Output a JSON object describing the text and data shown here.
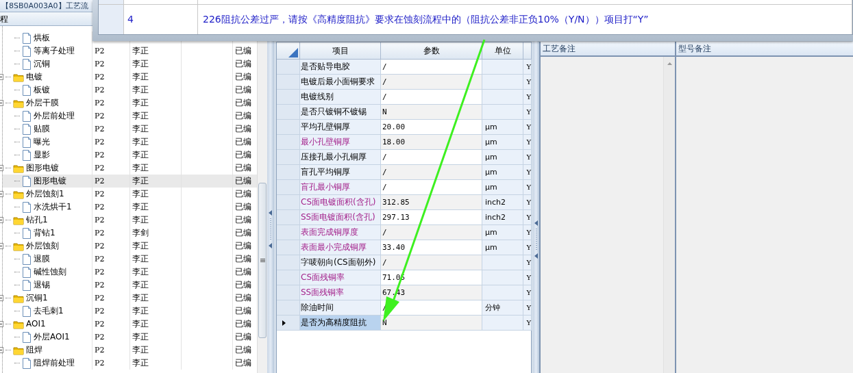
{
  "left_panel": {
    "title": "【8SB0A003A0】工艺流",
    "column_1": "程",
    "tree": [
      {
        "children": [
          {
            "label": "烘板",
            "selected": false
          },
          {
            "label": "等离子处理",
            "code": "P2",
            "owner": "李正",
            "status": "已编",
            "selected": false
          },
          {
            "label": "沉铜",
            "code": "P2",
            "owner": "李正",
            "status": "已编",
            "selected": false
          }
        ]
      },
      {
        "label": "电镀",
        "code": "P2",
        "owner": "李正",
        "status": "已编",
        "expanded": true,
        "selected": false,
        "children": [
          {
            "label": "板镀",
            "code": "P2",
            "owner": "李正",
            "status": "已编",
            "selected": false
          }
        ]
      },
      {
        "label": "外层干膜",
        "code": "P2",
        "owner": "李正",
        "status": "已编",
        "expanded": true,
        "selected": false,
        "children": [
          {
            "label": "外层前处理",
            "code": "P2",
            "owner": "李正",
            "status": "已编",
            "selected": false
          },
          {
            "label": "贴膜",
            "code": "P2",
            "owner": "李正",
            "status": "已编",
            "selected": false
          },
          {
            "label": "曝光",
            "code": "P2",
            "owner": "李正",
            "status": "已编",
            "selected": false
          },
          {
            "label": "显影",
            "code": "P2",
            "owner": "李正",
            "status": "已编",
            "selected": false
          }
        ]
      },
      {
        "label": "图形电镀",
        "code": "P2",
        "owner": "李正",
        "status": "已编",
        "expanded": true,
        "selected": false,
        "children": [
          {
            "label": "图形电镀",
            "code": "P2",
            "owner": "李正",
            "status": "已编",
            "selected": true
          }
        ]
      },
      {
        "label": "外层蚀刻1",
        "code": "P2",
        "owner": "李正",
        "status": "已编",
        "expanded": true,
        "selected": false,
        "children": [
          {
            "label": "水洗烘干1",
            "code": "P2",
            "owner": "李正",
            "status": "已编",
            "selected": false
          }
        ]
      },
      {
        "label": "钻孔1",
        "code": "P2",
        "owner": "李正",
        "status": "已编",
        "expanded": true,
        "selected": false,
        "children": [
          {
            "label": "背钻1",
            "code": "P2",
            "owner": "李剑",
            "status": "已编",
            "selected": false
          }
        ]
      },
      {
        "label": "外层蚀刻",
        "code": "P2",
        "owner": "李正",
        "status": "已编",
        "expanded": true,
        "selected": false,
        "children": [
          {
            "label": "退膜",
            "code": "P2",
            "owner": "李正",
            "status": "已编",
            "selected": false
          },
          {
            "label": "碱性蚀刻",
            "code": "P2",
            "owner": "李正",
            "status": "已编",
            "selected": false
          },
          {
            "label": "退锡",
            "code": "P2",
            "owner": "李正",
            "status": "已编",
            "selected": false
          }
        ]
      },
      {
        "label": "沉铜1",
        "code": "P2",
        "owner": "李正",
        "status": "已编",
        "expanded": true,
        "selected": false,
        "children": [
          {
            "label": "去毛刺1",
            "code": "P2",
            "owner": "李正",
            "status": "已编",
            "selected": false
          }
        ]
      },
      {
        "label": "AOI1",
        "code": "P2",
        "owner": "李正",
        "status": "已编",
        "expanded": true,
        "selected": false,
        "children": [
          {
            "label": "外层AOI1",
            "code": "P2",
            "owner": "李正",
            "status": "已编",
            "selected": false
          }
        ]
      },
      {
        "label": "阻焊",
        "code": "P2",
        "owner": "李正",
        "status": "已编",
        "expanded": true,
        "selected": false,
        "children": [
          {
            "label": "阻焊前处理",
            "code": "P2",
            "owner": "李正",
            "status": "已编",
            "selected": false
          }
        ]
      }
    ]
  },
  "popup": {
    "rows": [
      {
        "number": "4",
        "message": "226阻抗公差过严，请按《高精度阻抗》要求在蚀刻流程中的（阻抗公差非正负10%（Y/N））项目打“Y”"
      }
    ]
  },
  "param_grid": {
    "columns": [
      "项目",
      "参数",
      "单位"
    ],
    "rows": [
      {
        "item": "是否贴导电胶",
        "value": "/",
        "flag": "Y",
        "emphasized": false,
        "selected": false
      },
      {
        "item": "电镀后最小面铜要求",
        "value": "/",
        "flag": "Y",
        "emphasized": false,
        "selected": false
      },
      {
        "item": "电镀线别",
        "value": "/",
        "flag": "Y",
        "emphasized": false,
        "selected": false
      },
      {
        "item": "是否只镀铜不镀锡",
        "value": "N",
        "flag": "Y",
        "emphasized": false,
        "selected": false
      },
      {
        "item": "平均孔壁铜厚",
        "value": "20.00",
        "unit": "μm",
        "flag": "Y",
        "emphasized": false,
        "selected": false
      },
      {
        "item": "最小孔壁铜厚",
        "value": "18.00",
        "unit": "μm",
        "flag": "Y",
        "emphasized": true,
        "selected": false
      },
      {
        "item": "压接孔最小孔铜厚",
        "value": "/",
        "unit": "μm",
        "flag": "Y",
        "emphasized": false,
        "selected": false
      },
      {
        "item": "盲孔平均铜厚",
        "value": "/",
        "unit": "μm",
        "flag": "Y",
        "emphasized": false,
        "selected": false
      },
      {
        "item": "盲孔最小铜厚",
        "value": "/",
        "unit": "μm",
        "flag": "Y",
        "emphasized": true,
        "selected": false
      },
      {
        "item": "CS面电镀面积(含孔)",
        "value": "312.85",
        "unit": "inch2",
        "flag": "Y",
        "emphasized": true,
        "selected": false
      },
      {
        "item": "SS面电镀面积(含孔)",
        "value": "297.13",
        "unit": "inch2",
        "flag": "Y",
        "emphasized": true,
        "selected": false
      },
      {
        "item": "表面完成铜厚度",
        "value": "/",
        "unit": "μm",
        "flag": "Y",
        "emphasized": true,
        "selected": false
      },
      {
        "item": "表面最小完成铜厚",
        "value": "33.40",
        "unit": "μm",
        "flag": "Y",
        "emphasized": true,
        "selected": false
      },
      {
        "item": "字唛朝向(CS面朝外)",
        "value": "/",
        "flag": "Y",
        "emphasized": false,
        "selected": false
      },
      {
        "item": "CS面残铜率",
        "value": "71.05",
        "flag": "Y",
        "emphasized": true,
        "selected": false
      },
      {
        "item": "SS面残铜率",
        "value": "67.43",
        "flag": "Y",
        "emphasized": true,
        "selected": false
      },
      {
        "item": "除油时间",
        "value": "/",
        "unit": "分钟",
        "flag": "Y",
        "emphasized": false,
        "selected": false
      },
      {
        "item": "是否为高精度阻抗",
        "value": "N",
        "flag": "Y",
        "emphasized": false,
        "selected": true
      }
    ]
  },
  "notes": [
    {
      "title": "工艺备注"
    },
    {
      "title": "型号备注"
    }
  ],
  "annotation": {
    "kind": "arrow"
  }
}
